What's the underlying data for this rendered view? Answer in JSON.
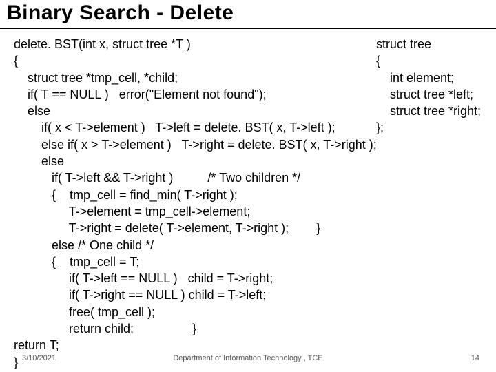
{
  "title": "Binary Search - Delete",
  "code": "delete. BST(int x, struct tree *T )\n{\n    struct tree *tmp_cell, *child;\n    if( T == NULL )   error(\"Element not found\");\n    else\n        if( x < T->element )   T->left = delete. BST( x, T->left );\n        else if( x > T->element )   T->right = delete. BST( x, T->right );\n        else\n           if( T->left && T->right )          /* Two children */\n           {    tmp_cell = find_min( T->right );\n                T->element = tmp_cell->element;\n                T->right = delete( T->element, T->right );        }\n           else /* One child */\n           {    tmp_cell = T;\n                if( T->left == NULL )   child = T->right;\n                if( T->right == NULL ) child = T->left;\n                free( tmp_cell );\n                return child;                 }\nreturn T;\n}",
  "struct_def": "struct tree\n{\n    int element;\n    struct tree *left;\n    struct tree *right;\n};",
  "footer": {
    "date": "3/10/2021",
    "dept": "Department of Information Technology , TCE",
    "page": "14"
  }
}
